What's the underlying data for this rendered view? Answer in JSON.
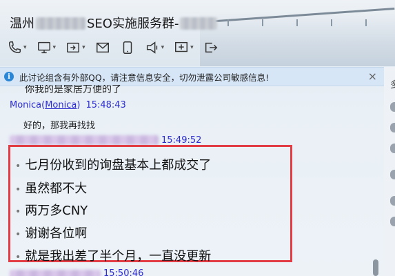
{
  "window": {
    "title_prefix": "温州",
    "title_suffix": "SEO实施服务群-"
  },
  "toolbar": {
    "icons": [
      "phone-icon",
      "screen-share-icon",
      "remote-assist-icon",
      "mail-icon",
      "tablet-icon",
      "announcement-icon",
      "add-apps-icon",
      "exit-icon"
    ]
  },
  "notice": {
    "icon": "i",
    "text": "此讨论组含有外部QQ，请注意信息安全，切勿泄露公司敏感信息!",
    "close": "×"
  },
  "chat": {
    "partial_text": "你我的是家居万便的了",
    "messages": [
      {
        "name": "Monica",
        "paren_open": "(",
        "handle": "Monica",
        "paren_close": ")",
        "time": "15:48:43",
        "text": "好的，那我再找找"
      },
      {
        "time": "15:49:52"
      },
      {
        "time": "15:50:46"
      }
    ],
    "highlight_lines": [
      "七月份收到的询盘基本上都成交了",
      "虽然都不大",
      "两万多CNY",
      "谢谢各位啊",
      "就是我出差了半个月，一直没更新"
    ],
    "bullet": "•"
  },
  "side": {
    "text": "多"
  }
}
